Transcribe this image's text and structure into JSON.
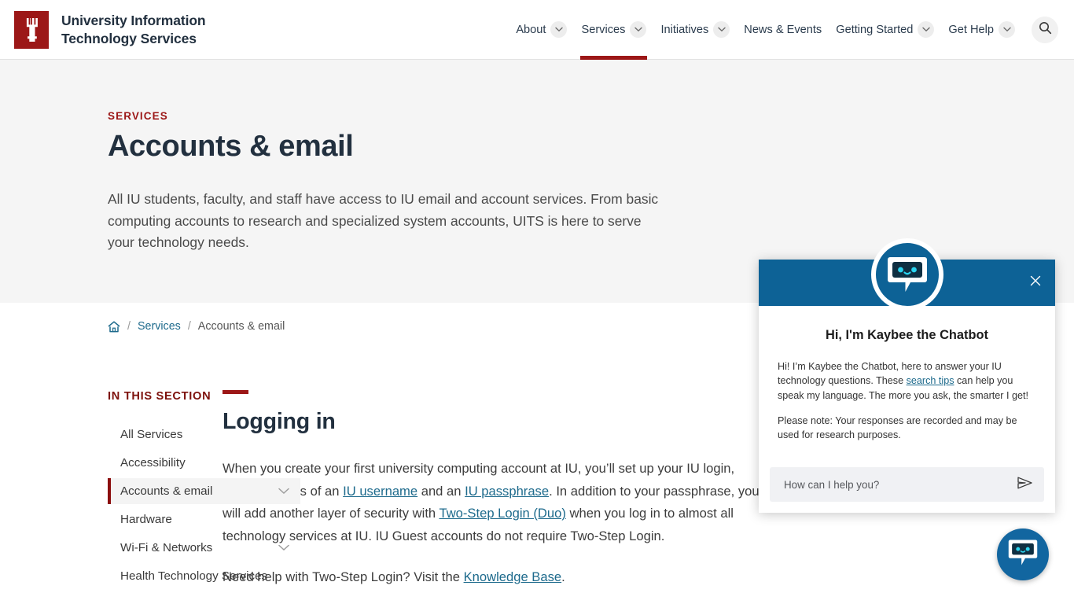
{
  "header": {
    "logo_alt": "Indiana University trident",
    "brand_line1": "University Information",
    "brand_line2": "Technology Services",
    "nav": [
      {
        "label": "About",
        "has_caret": true,
        "active": false
      },
      {
        "label": "Services",
        "has_caret": true,
        "active": true
      },
      {
        "label": "Initiatives",
        "has_caret": true,
        "active": false
      },
      {
        "label": "News & Events",
        "has_caret": false,
        "active": false
      },
      {
        "label": "Getting Started",
        "has_caret": true,
        "active": false
      },
      {
        "label": "Get Help",
        "has_caret": true,
        "active": false
      }
    ],
    "search_label": "Search"
  },
  "hero": {
    "eyebrow": "SERVICES",
    "title": "Accounts & email",
    "description": "All IU students, faculty, and staff have access to IU email and account services. From basic computing accounts to research and specialized system accounts, UITS is here to serve your technology needs."
  },
  "breadcrumb": {
    "home_label": "Home",
    "sep": "/",
    "items": [
      {
        "label": "Services",
        "link": true
      },
      {
        "label": "Accounts & email",
        "link": false
      }
    ]
  },
  "sidebar": {
    "heading": "IN THIS SECTION",
    "items": [
      {
        "label": "All Services",
        "expandable": false,
        "active": false
      },
      {
        "label": "Accessibility",
        "expandable": false,
        "active": false
      },
      {
        "label": "Accounts & email",
        "expandable": true,
        "active": true
      },
      {
        "label": "Hardware",
        "expandable": false,
        "active": false
      },
      {
        "label": "Wi-Fi & Networks",
        "expandable": true,
        "active": false
      },
      {
        "label": "Health Technology Services",
        "expandable": false,
        "active": false
      }
    ]
  },
  "main": {
    "heading": "Logging in",
    "para1_a": "When you create your first university computing account at IU, you’ll set up your IU login, which consists of an ",
    "link_username": "IU username",
    "para1_b": " and an ",
    "link_passphrase": "IU passphrase",
    "para1_c": ". In addition to your passphrase, you will add another layer of security with ",
    "link_duo": "Two-Step Login (Duo)",
    "para1_d": " when you log in to almost all technology services at IU. IU Guest accounts do not require Two-Step Login.",
    "para2_a": "Need help with Two-Step Login? Visit the ",
    "link_kb": "Knowledge Base",
    "para2_b": "."
  },
  "chat": {
    "title": "Hi, I'm Kaybee the Chatbot",
    "msg1_a": "Hi! I’m Kaybee the Chatbot, here to answer your IU technology questions. These ",
    "msg1_link": "search tips",
    "msg1_b": " can help you speak my language. The more you ask, the smarter I get!",
    "msg2": "Please note: Your responses are recorded and may be used for research purposes.",
    "input_placeholder": "How can I help you?",
    "input_value": "",
    "close_label": "Close",
    "send_label": "Send",
    "avatar_name": "chatbot-avatar",
    "fab_label": "Open chat"
  },
  "colors": {
    "crimson": "#9c1717",
    "dark_crimson": "#7d110c",
    "chat_blue": "#0d6296",
    "fab_blue": "#1266a0",
    "link_blue": "#1d6a8c",
    "heading_navy": "#22303f",
    "hero_bg": "#f5f5f5"
  }
}
